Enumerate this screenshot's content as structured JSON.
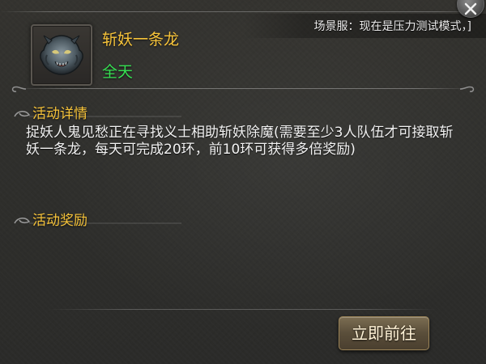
{
  "banner": {
    "system_message": "场景服：现在是压力测试模式，]"
  },
  "activity": {
    "icon": "dragon-head-icon",
    "title": "斩妖一条龙",
    "time": "全天"
  },
  "sections": {
    "details": {
      "heading": "活动详情",
      "text": "捉妖人鬼见愁正在寻找义士相助斩妖除魔(需要至少3人队伍才可接取斩妖一条龙，每天可完成20环，前10环可获得多倍奖励)"
    },
    "rewards": {
      "heading": "活动奖励"
    }
  },
  "actions": {
    "go_label": "立即前往"
  },
  "colors": {
    "title_gold": "#f6c33a",
    "time_green": "#36e052",
    "text_white": "#f2f2f2",
    "panel_bg": "#2f2f2c"
  }
}
